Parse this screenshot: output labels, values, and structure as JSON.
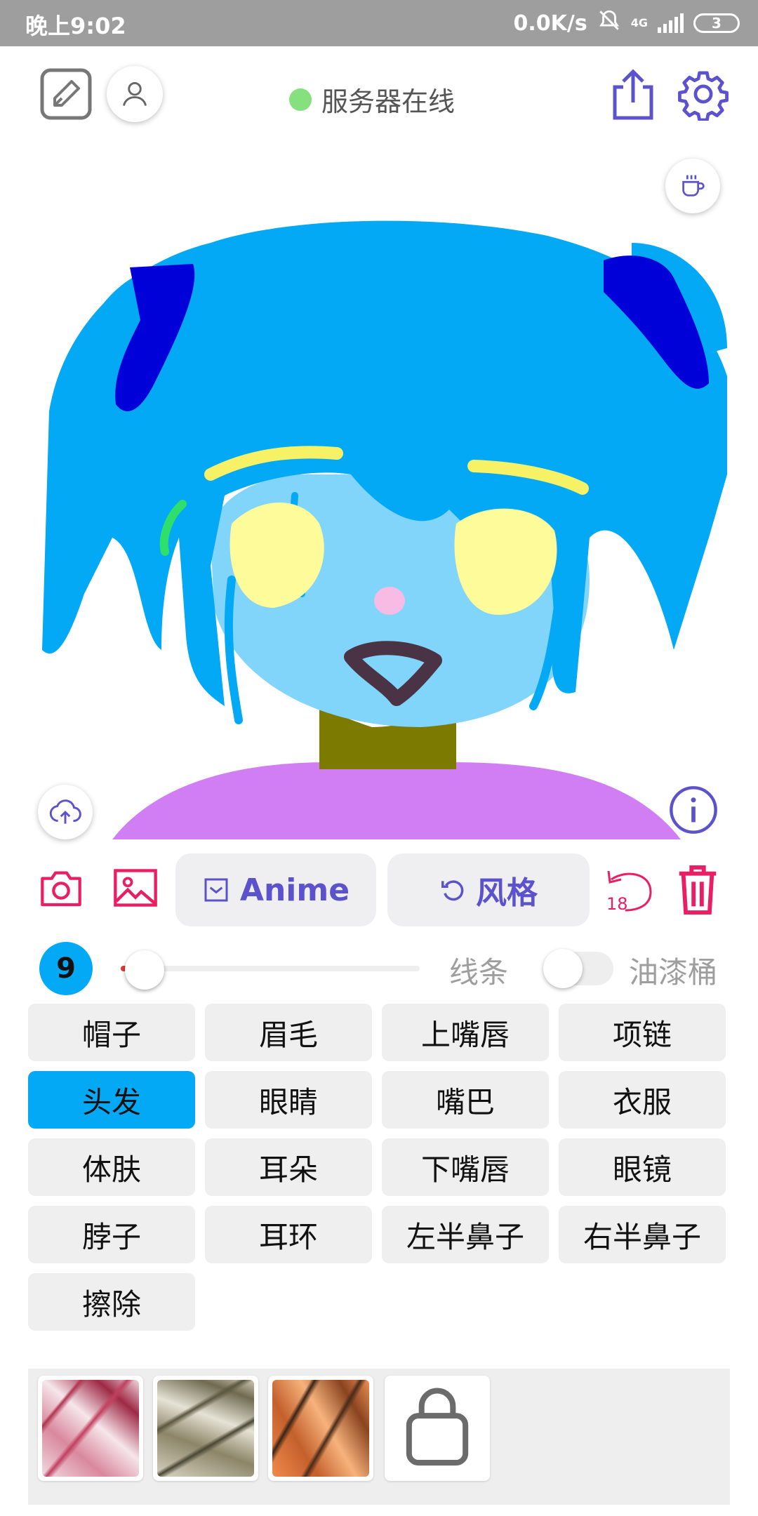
{
  "status_bar": {
    "time": "晚上9:02",
    "net_speed": "0.0K/s",
    "network": "4G",
    "battery": "3"
  },
  "header": {
    "server_status": "服务器在线",
    "server_status_color": "#86e07d"
  },
  "actions": {
    "anime_label": "Anime",
    "style_label": "风格",
    "undo_count": "18"
  },
  "brush": {
    "size": "9",
    "size_level": 0.08,
    "lines_label": "线条",
    "bucket_label": "油漆桶",
    "bucket_enabled": false
  },
  "parts": [
    {
      "label": "帽子",
      "active": false
    },
    {
      "label": "眉毛",
      "active": false
    },
    {
      "label": "上嘴唇",
      "active": false
    },
    {
      "label": "项链",
      "active": false
    },
    {
      "label": "头发",
      "active": true
    },
    {
      "label": "眼睛",
      "active": false
    },
    {
      "label": "嘴巴",
      "active": false
    },
    {
      "label": "衣服",
      "active": false
    },
    {
      "label": "体肤",
      "active": false
    },
    {
      "label": "耳朵",
      "active": false
    },
    {
      "label": "下嘴唇",
      "active": false
    },
    {
      "label": "眼镜",
      "active": false
    },
    {
      "label": "脖子",
      "active": false
    },
    {
      "label": "耳环",
      "active": false
    },
    {
      "label": "左半鼻子",
      "active": false
    },
    {
      "label": "右半鼻子",
      "active": false
    },
    {
      "label": "擦除",
      "active": false
    }
  ],
  "colors": {
    "accent": "#5b52cc",
    "selected": "#03a9f4",
    "danger": "#e91e63"
  }
}
